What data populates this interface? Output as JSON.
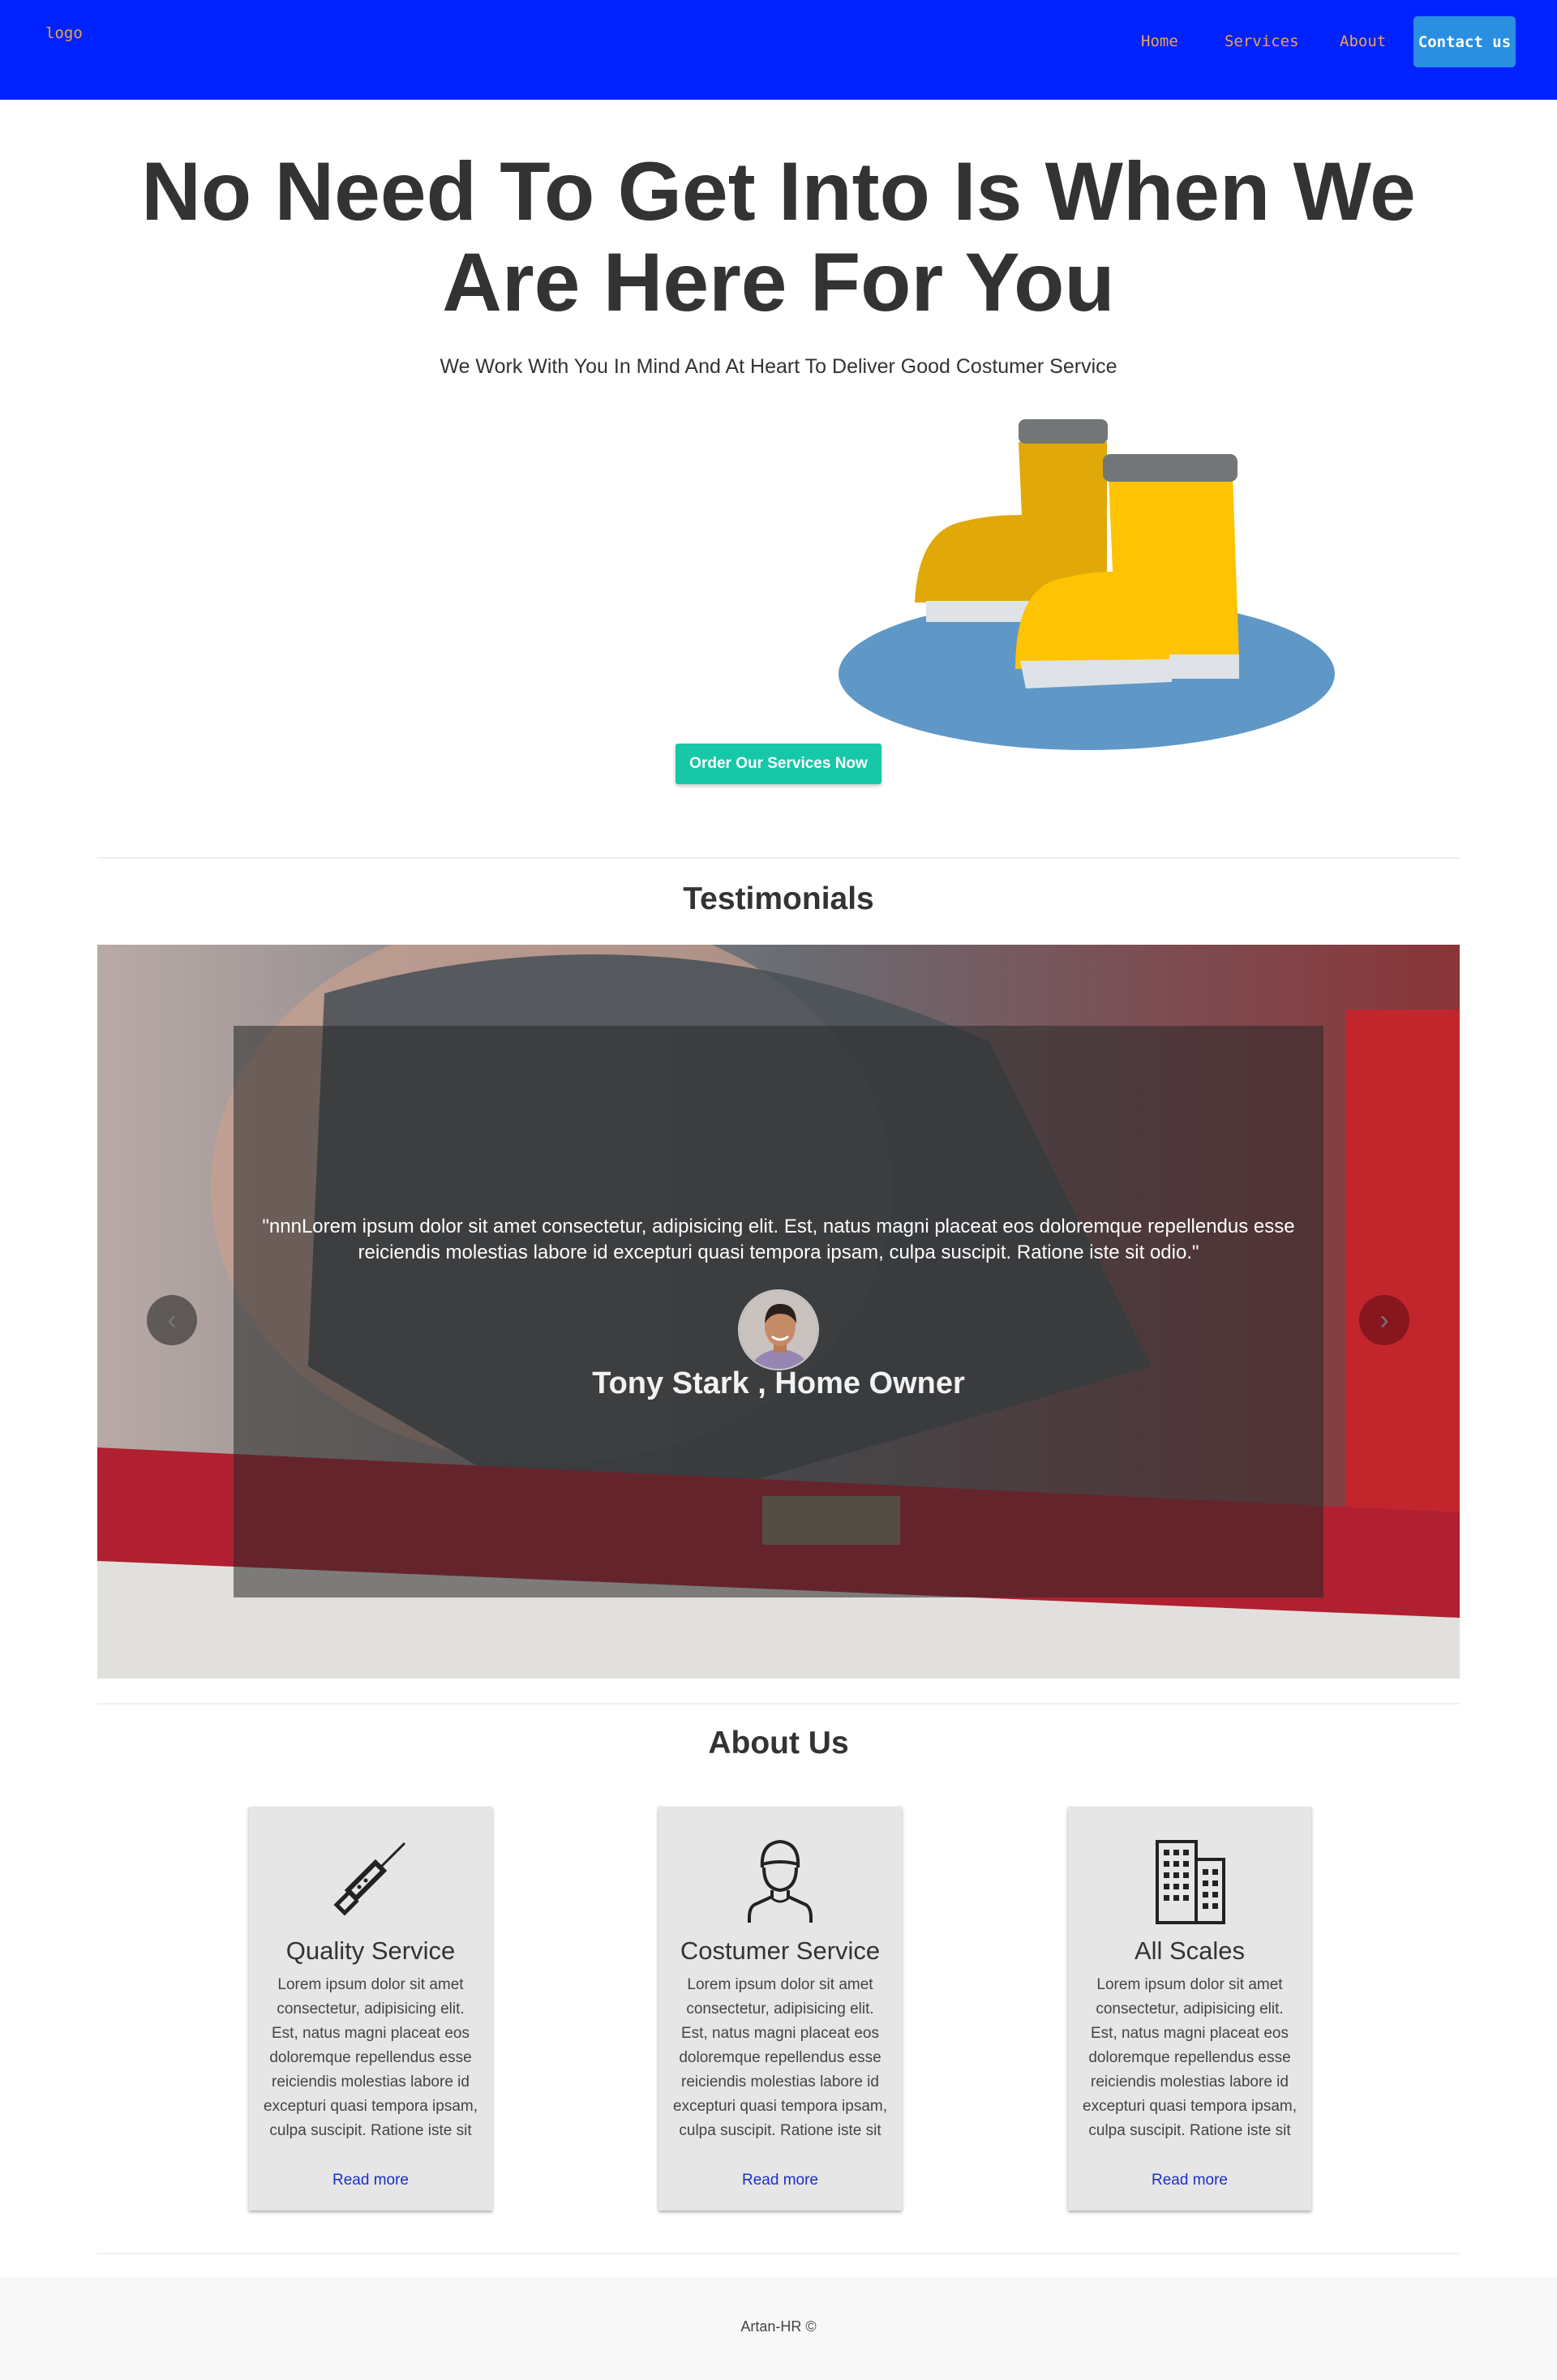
{
  "nav": {
    "logo": "logo",
    "links": [
      "Home",
      "Services",
      "About"
    ],
    "contact_label": "Contact us",
    "background": "#0022ff",
    "link_color": "#f0a050"
  },
  "hero": {
    "title": "No Need To Get Into Is When We Are Here For You",
    "subtitle": "We Work With You In Mind And At Heart To Deliver Good Costumer Service",
    "illustration": "yellow-boots-in-puddle",
    "cta_label": "Order Our Services Now",
    "cta_color": "#16c8a8"
  },
  "testimonials": {
    "heading": "Testimonials",
    "quote": "\"nnnLorem ipsum dolor sit amet consectetur, adipisicing elit. Est, natus magni placeat eos doloremque repellendus esse reiciendis molestias labore id excepturi quasi tempora ipsam, culpa suscipit. Ratione iste sit odio.\"",
    "author": "Tony Stark , Home Owner",
    "prev_icon": "chevron-left-icon",
    "next_icon": "chevron-right-icon"
  },
  "about": {
    "heading": "About Us",
    "cards": [
      {
        "icon": "screwdriver-icon",
        "title": "Quality Service",
        "text": "Lorem ipsum dolor sit amet consectetur, adipisicing elit. Est, natus magni placeat eos doloremque repellendus esse reiciendis molestias labore id excepturi quasi tempora ipsam, culpa suscipit. Ratione iste sit",
        "link": "Read more"
      },
      {
        "icon": "person-icon",
        "title": "Costumer Service",
        "text": "Lorem ipsum dolor sit amet consectetur, adipisicing elit. Est, natus magni placeat eos doloremque repellendus esse reiciendis molestias labore id excepturi quasi tempora ipsam, culpa suscipit. Ratione iste sit",
        "link": "Read more"
      },
      {
        "icon": "building-icon",
        "title": "All Scales",
        "text": "Lorem ipsum dolor sit amet consectetur, adipisicing elit. Est, natus magni placeat eos doloremque repellendus esse reiciendis molestias labore id excepturi quasi tempora ipsam, culpa suscipit. Ratione iste sit",
        "link": "Read more"
      }
    ]
  },
  "footer": {
    "text": "Artan-HR ©"
  }
}
